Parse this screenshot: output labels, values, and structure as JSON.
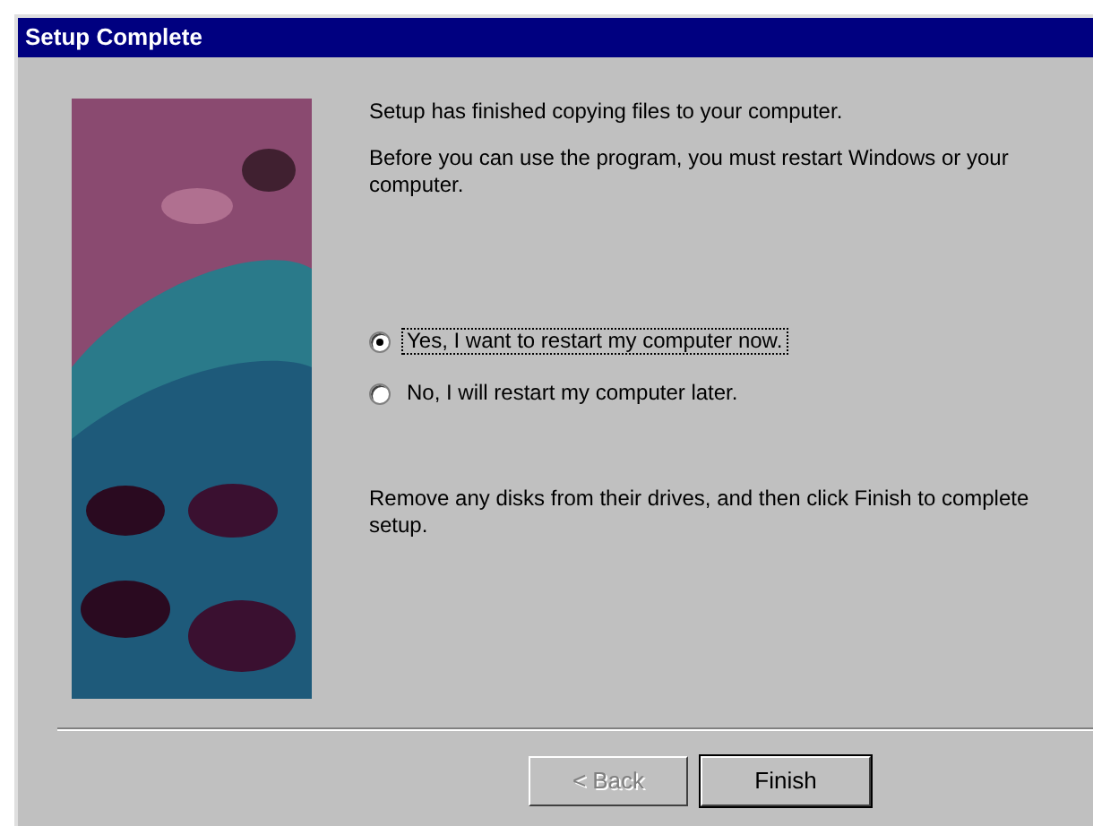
{
  "window": {
    "title": "Setup Complete"
  },
  "messages": [
    "Setup has finished copying files to your computer.",
    "Before you can use the program, you must restart Windows or your computer."
  ],
  "options": [
    {
      "label": "Yes, I want to restart my computer now.",
      "selected": true,
      "focused": true
    },
    {
      "label": "No, I will restart my computer later.",
      "selected": false,
      "focused": false
    }
  ],
  "instruction": "Remove any disks from their drives, and then click Finish to complete setup.",
  "buttons": [
    {
      "label": "< Back",
      "disabled": true,
      "default": false
    },
    {
      "label": "Finish",
      "disabled": false,
      "default": true
    }
  ]
}
